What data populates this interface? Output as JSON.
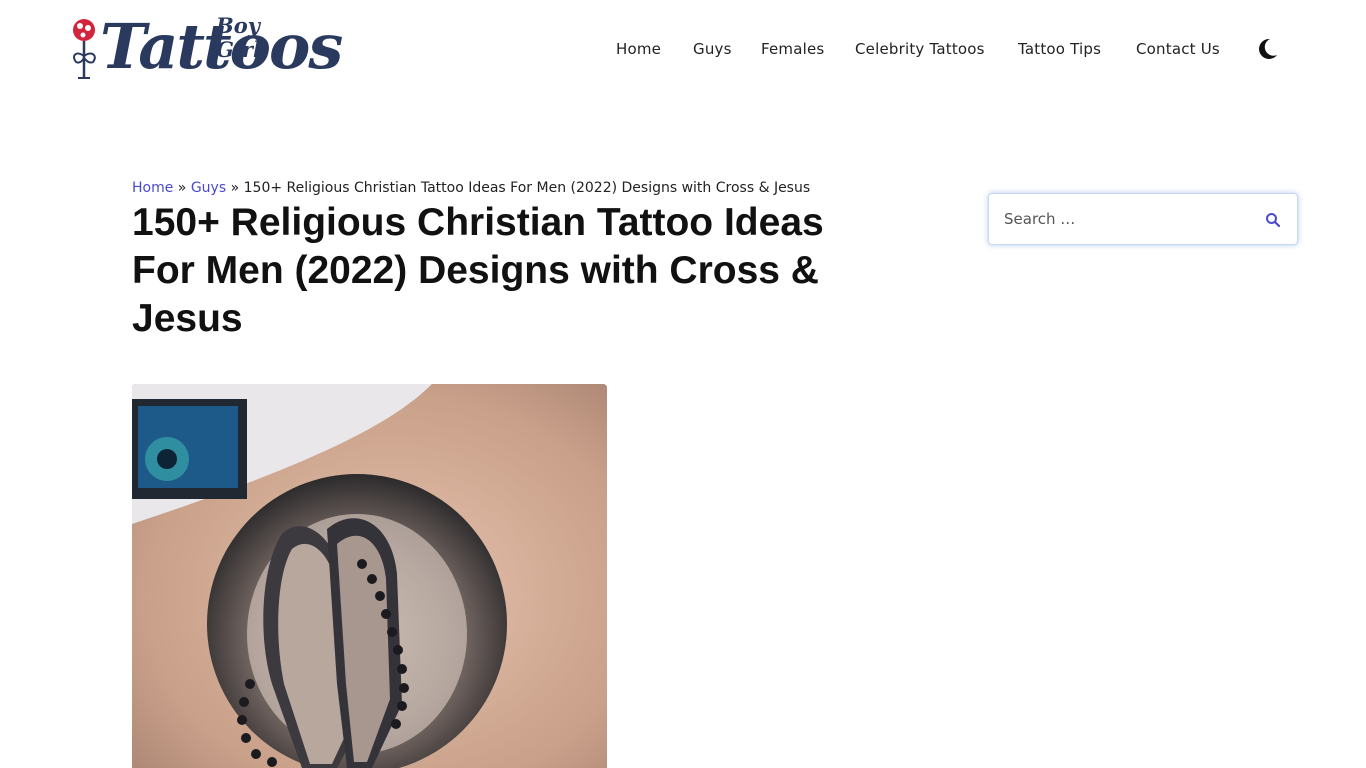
{
  "site": {
    "logo_text": "Tattoos",
    "logo_subtext": "Boy Girl",
    "logo_icon": "rose-icon"
  },
  "nav": {
    "items": [
      {
        "label": "Home"
      },
      {
        "label": "Guys"
      },
      {
        "label": "Females"
      },
      {
        "label": "Celebrity Tattoos"
      },
      {
        "label": "Tattoo Tips"
      },
      {
        "label": "Contact Us"
      }
    ],
    "dark_mode_icon": "moon-icon"
  },
  "breadcrumb": {
    "home": "Home",
    "separator": "»",
    "category": "Guys",
    "current": "150+ Religious Christian Tattoo Ideas For Men (2022) Designs with Cross & Jesus"
  },
  "article": {
    "title": "150+ Religious Christian Tattoo Ideas For Men (2022) Designs with Cross & Jesus"
  },
  "search": {
    "placeholder": "Search …",
    "icon": "search-icon"
  },
  "colors": {
    "link": "#4a4ad0",
    "logo": "#2a3a5f",
    "logo_accent": "#d2243c",
    "search_glow": "#78a0dc"
  }
}
